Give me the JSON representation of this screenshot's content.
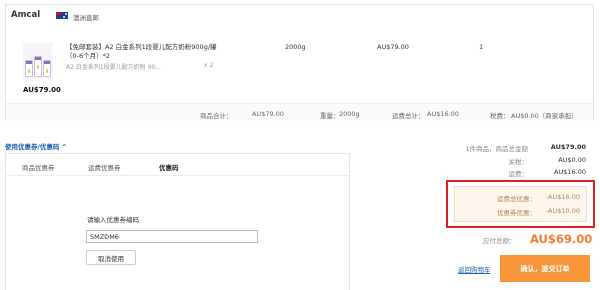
{
  "store": {
    "name": "Amcal",
    "origin": "澳洲直邮",
    "flag_icon": "australia-flag-icon"
  },
  "product": {
    "title": "【免邮套装】A2 白金系列1段婴儿配方奶粉900g/罐（0-6个月）*2",
    "subtitle": "A2 白金系列1段婴儿配方奶粉 90...",
    "sub_qty": "x 2",
    "weight": "2000g",
    "price": "AU$79.00",
    "count": "1",
    "thumb_price": "AU$79.00"
  },
  "summary": {
    "goods_label": "商品合计：",
    "goods_value": "AU$79.00",
    "weight_label": "重量：",
    "weight_value": "2000g",
    "shipping_label": "运费总计：",
    "shipping_value": "AU$16.00",
    "tax_label": "税费：",
    "tax_value": "AU$0.00（商家承担）"
  },
  "coupon": {
    "toggle_label": "使用优惠券/优惠码 ^",
    "tabs": [
      "商品优惠券",
      "运费优惠券",
      "优惠码"
    ],
    "active_tab": "优惠码",
    "code_label": "请输入优惠券编码",
    "code_value": "SMZDM6",
    "cancel_label": "取消使用"
  },
  "totals": {
    "count_goods_label": "1件商品，商品总金额",
    "count_goods_value": "AU$79.00",
    "duty_label": "关税：",
    "duty_value": "AU$0.00",
    "freight_label": "运费：",
    "freight_value": "AU$16.00"
  },
  "discounts": {
    "shipping_discount_label": "运费总优惠：",
    "shipping_discount_value": "-AU$16.00",
    "promo_discount_label": "优惠券优惠：",
    "promo_discount_value": "-AU$10.00"
  },
  "due": {
    "label": "应付总额：",
    "amount": "AU$69.00"
  },
  "actions": {
    "return_cart": "返回购物车",
    "confirm": "确认，提交订单"
  },
  "colors": {
    "accent": "#f7953a",
    "due_amount": "#f97a2c",
    "link": "#1c5fb0",
    "highlight_border": "#e02020"
  }
}
